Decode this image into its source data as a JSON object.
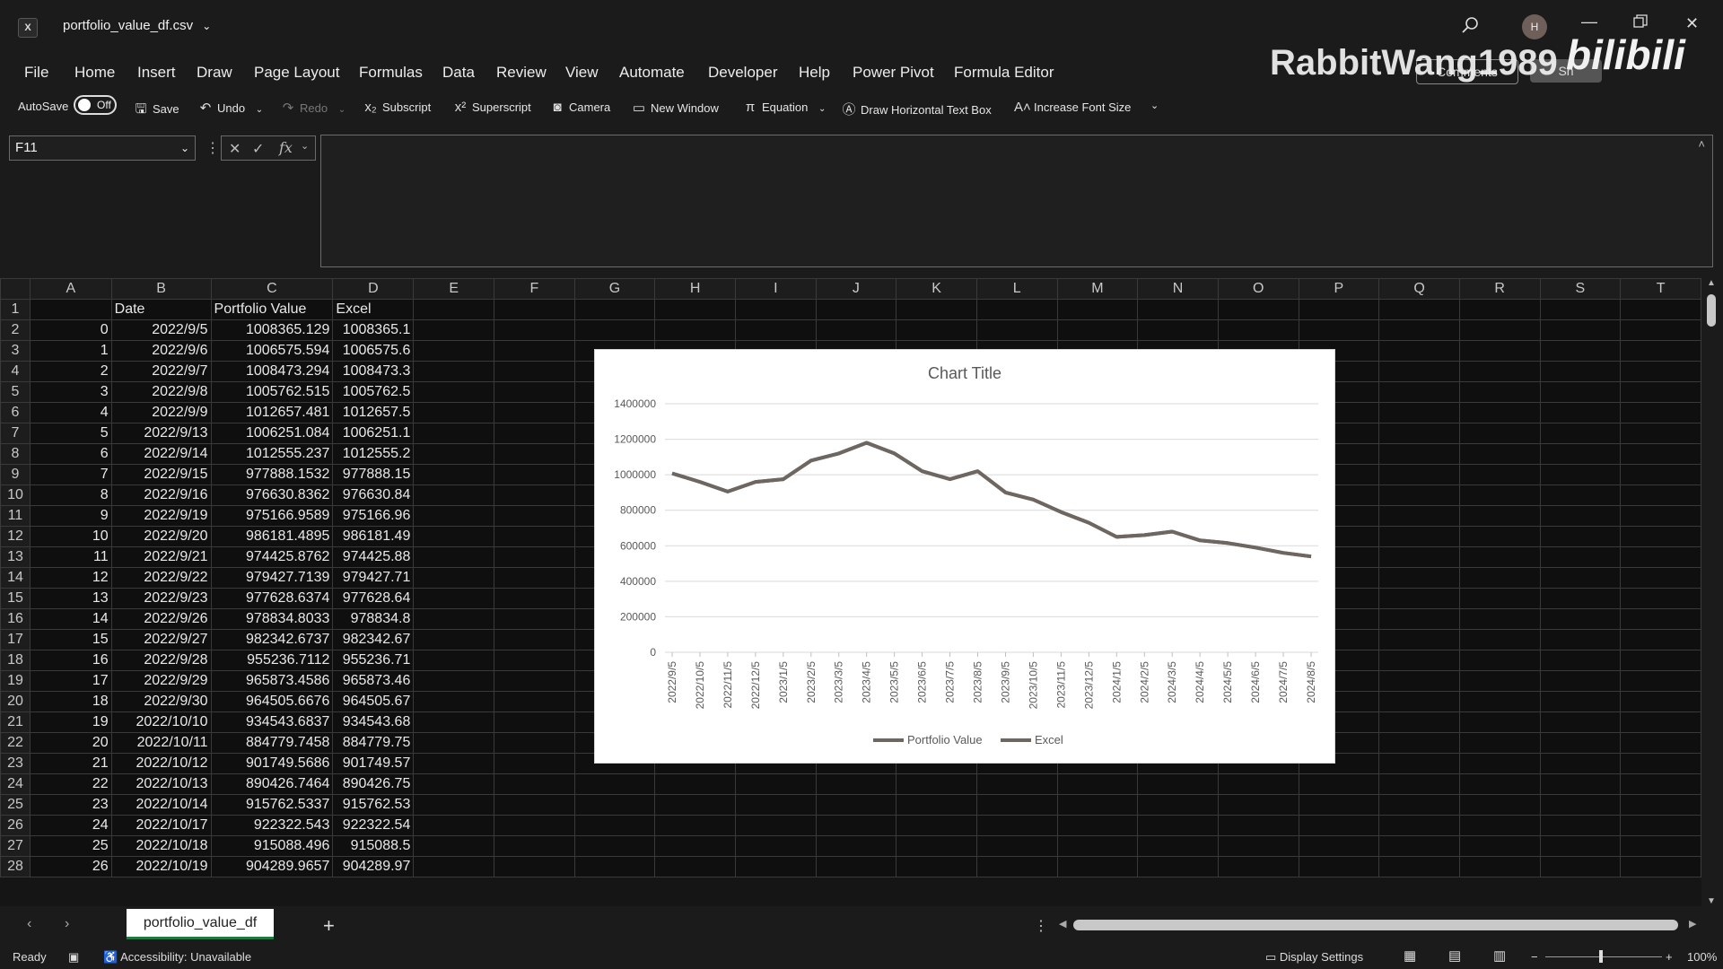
{
  "window": {
    "app_icon": "excel-icon",
    "filename": "portfolio_value_df.csv",
    "avatar_initial": "H"
  },
  "menu": [
    "File",
    "Home",
    "Insert",
    "Draw",
    "Page Layout",
    "Formulas",
    "Data",
    "Review",
    "View",
    "Automate",
    "Developer",
    "Help",
    "Power Pivot",
    "Formula Editor"
  ],
  "ribbon_right": {
    "comments": "Comments",
    "share": "Sh"
  },
  "watermark": {
    "user": "RabbitWang1989",
    "logo": "bilibili"
  },
  "qat": {
    "autosave_label": "AutoSave",
    "autosave_state": "Off",
    "save": "Save",
    "undo": "Undo",
    "redo": "Redo",
    "subscript": "Subscript",
    "superscript": "Superscript",
    "camera": "Camera",
    "new_window": "New Window",
    "equation": "Equation",
    "draw_text_box": "Draw Horizontal Text Box",
    "increase_font": "Increase Font Size"
  },
  "formula_bar": {
    "name_box": "F11",
    "formula": ""
  },
  "columns": [
    "A",
    "B",
    "C",
    "D",
    "E",
    "F",
    "G",
    "H",
    "I",
    "J",
    "K",
    "L",
    "M",
    "N",
    "O",
    "P",
    "Q",
    "R",
    "S",
    "T"
  ],
  "header_row": {
    "A": "",
    "B": "Date",
    "C": "Portfolio Value",
    "D": "Excel"
  },
  "rows": [
    {
      "r": "2",
      "a": "0",
      "b": "2022/9/5",
      "c": "1008365.129",
      "d": "1008365.1"
    },
    {
      "r": "3",
      "a": "1",
      "b": "2022/9/6",
      "c": "1006575.594",
      "d": "1006575.6"
    },
    {
      "r": "4",
      "a": "2",
      "b": "2022/9/7",
      "c": "1008473.294",
      "d": "1008473.3"
    },
    {
      "r": "5",
      "a": "3",
      "b": "2022/9/8",
      "c": "1005762.515",
      "d": "1005762.5"
    },
    {
      "r": "6",
      "a": "4",
      "b": "2022/9/9",
      "c": "1012657.481",
      "d": "1012657.5"
    },
    {
      "r": "7",
      "a": "5",
      "b": "2022/9/13",
      "c": "1006251.084",
      "d": "1006251.1"
    },
    {
      "r": "8",
      "a": "6",
      "b": "2022/9/14",
      "c": "1012555.237",
      "d": "1012555.2"
    },
    {
      "r": "9",
      "a": "7",
      "b": "2022/9/15",
      "c": "977888.1532",
      "d": "977888.15"
    },
    {
      "r": "10",
      "a": "8",
      "b": "2022/9/16",
      "c": "976630.8362",
      "d": "976630.84"
    },
    {
      "r": "11",
      "a": "9",
      "b": "2022/9/19",
      "c": "975166.9589",
      "d": "975166.96"
    },
    {
      "r": "12",
      "a": "10",
      "b": "2022/9/20",
      "c": "986181.4895",
      "d": "986181.49"
    },
    {
      "r": "13",
      "a": "11",
      "b": "2022/9/21",
      "c": "974425.8762",
      "d": "974425.88"
    },
    {
      "r": "14",
      "a": "12",
      "b": "2022/9/22",
      "c": "979427.7139",
      "d": "979427.71"
    },
    {
      "r": "15",
      "a": "13",
      "b": "2022/9/23",
      "c": "977628.6374",
      "d": "977628.64"
    },
    {
      "r": "16",
      "a": "14",
      "b": "2022/9/26",
      "c": "978834.8033",
      "d": "978834.8"
    },
    {
      "r": "17",
      "a": "15",
      "b": "2022/9/27",
      "c": "982342.6737",
      "d": "982342.67"
    },
    {
      "r": "18",
      "a": "16",
      "b": "2022/9/28",
      "c": "955236.7112",
      "d": "955236.71"
    },
    {
      "r": "19",
      "a": "17",
      "b": "2022/9/29",
      "c": "965873.4586",
      "d": "965873.46"
    },
    {
      "r": "20",
      "a": "18",
      "b": "2022/9/30",
      "c": "964505.6676",
      "d": "964505.67"
    },
    {
      "r": "21",
      "a": "19",
      "b": "2022/10/10",
      "c": "934543.6837",
      "d": "934543.68"
    },
    {
      "r": "22",
      "a": "20",
      "b": "2022/10/11",
      "c": "884779.7458",
      "d": "884779.75"
    },
    {
      "r": "23",
      "a": "21",
      "b": "2022/10/12",
      "c": "901749.5686",
      "d": "901749.57"
    },
    {
      "r": "24",
      "a": "22",
      "b": "2022/10/13",
      "c": "890426.7464",
      "d": "890426.75"
    },
    {
      "r": "25",
      "a": "23",
      "b": "2022/10/14",
      "c": "915762.5337",
      "d": "915762.53"
    },
    {
      "r": "26",
      "a": "24",
      "b": "2022/10/17",
      "c": "922322.543",
      "d": "922322.54"
    },
    {
      "r": "27",
      "a": "25",
      "b": "2022/10/18",
      "c": "915088.496",
      "d": "915088.5"
    },
    {
      "r": "28",
      "a": "26",
      "b": "2022/10/19",
      "c": "904289.9657",
      "d": "904289.97"
    }
  ],
  "chart_data": {
    "type": "line",
    "title": "Chart Title",
    "ylim": [
      0,
      1400000
    ],
    "yticks": [
      "0",
      "200000",
      "400000",
      "600000",
      "800000",
      "1000000",
      "1200000",
      "1400000"
    ],
    "categories": [
      "2022/9/5",
      "2022/10/5",
      "2022/11/5",
      "2022/12/5",
      "2023/1/5",
      "2023/2/5",
      "2023/3/5",
      "2023/4/5",
      "2023/5/5",
      "2023/6/5",
      "2023/7/5",
      "2023/8/5",
      "2023/9/5",
      "2023/10/5",
      "2023/11/5",
      "2023/12/5",
      "2024/1/5",
      "2024/2/5",
      "2024/3/5",
      "2024/4/5",
      "2024/5/5",
      "2024/6/5",
      "2024/7/5",
      "2024/8/5"
    ],
    "series": [
      {
        "name": "Portfolio Value",
        "color": "#6e6660",
        "values": [
          1008000,
          960000,
          905000,
          960000,
          975000,
          1080000,
          1120000,
          1180000,
          1120000,
          1020000,
          975000,
          1020000,
          900000,
          860000,
          790000,
          730000,
          650000,
          660000,
          680000,
          630000,
          615000,
          590000,
          560000,
          540000
        ]
      },
      {
        "name": "Excel",
        "color": "#6e6660",
        "values": [
          1008000,
          960000,
          905000,
          960000,
          975000,
          1080000,
          1120000,
          1180000,
          1120000,
          1020000,
          975000,
          1020000,
          900000,
          860000,
          790000,
          730000,
          650000,
          660000,
          680000,
          630000,
          615000,
          590000,
          560000,
          540000
        ]
      }
    ],
    "legend_position": "bottom",
    "grid": true
  },
  "sheet_tab": "portfolio_value_df",
  "status": {
    "ready": "Ready",
    "accessibility": "Accessibility: Unavailable",
    "display_settings": "Display Settings",
    "zoom": "100%"
  }
}
